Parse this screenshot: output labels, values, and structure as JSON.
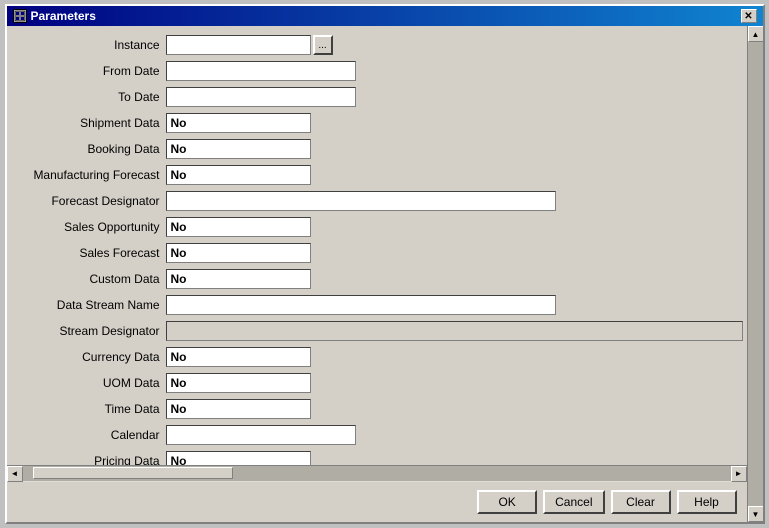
{
  "dialog": {
    "title": "Parameters",
    "icon_text": "P"
  },
  "rows": [
    {
      "label": "Instance",
      "type": "instance",
      "value": ""
    },
    {
      "label": "From Date",
      "type": "text_medium",
      "value": ""
    },
    {
      "label": "To Date",
      "type": "text_medium",
      "value": ""
    },
    {
      "label": "Shipment Data",
      "type": "no_value",
      "value": "No"
    },
    {
      "label": "Booking Data",
      "type": "no_value",
      "value": "No"
    },
    {
      "label": "Manufacturing Forecast",
      "type": "no_value",
      "value": "No"
    },
    {
      "label": "Forecast Designator",
      "type": "text_long",
      "value": ""
    },
    {
      "label": "Sales Opportunity",
      "type": "no_value",
      "value": "No"
    },
    {
      "label": "Sales Forecast",
      "type": "no_value",
      "value": "No"
    },
    {
      "label": "Custom Data",
      "type": "no_value",
      "value": "No"
    },
    {
      "label": "Data Stream Name",
      "type": "text_long",
      "value": ""
    },
    {
      "label": "Stream Designator",
      "type": "gray_full",
      "value": ""
    },
    {
      "label": "Currency Data",
      "type": "no_value",
      "value": "No"
    },
    {
      "label": "UOM Data",
      "type": "no_value",
      "value": "No"
    },
    {
      "label": "Time Data",
      "type": "no_value",
      "value": "No"
    },
    {
      "label": "Calendar",
      "type": "text_medium",
      "value": ""
    },
    {
      "label": "Pricing Data",
      "type": "no_value",
      "value": "No"
    }
  ],
  "buttons": {
    "ok": "OK",
    "cancel": "Cancel",
    "clear": "Clear",
    "help": "Help"
  },
  "scrollbar": {
    "up_arrow": "▲",
    "down_arrow": "▼",
    "left_arrow": "◄",
    "right_arrow": "►"
  }
}
